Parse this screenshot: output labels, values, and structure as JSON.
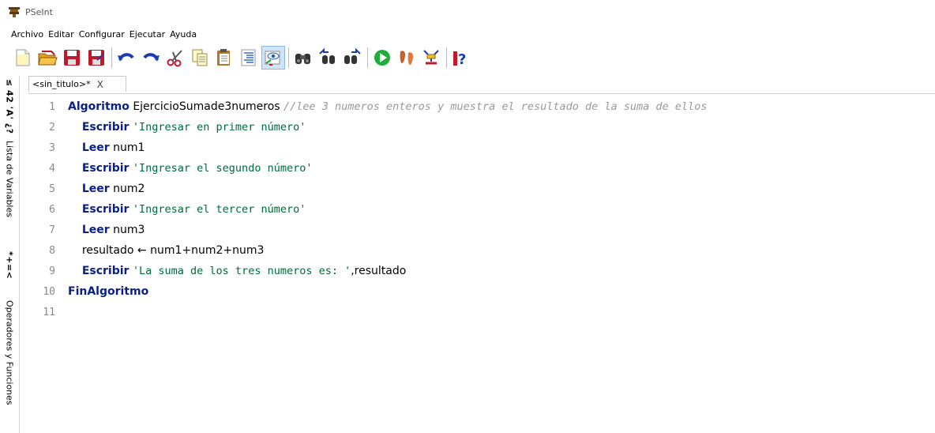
{
  "app": {
    "title": "PSeInt"
  },
  "menu": [
    "Archivo",
    "Editar",
    "Configurar",
    "Ejecutar",
    "Ayuda"
  ],
  "toolbar": {
    "buttons": [
      "new-file-icon",
      "open-folder-icon",
      "save-icon",
      "save-as-icon",
      "undo-icon",
      "redo-icon",
      "cut-icon",
      "copy-icon",
      "paste-icon",
      "indent-icon",
      "inspect-icon",
      "find-icon",
      "find-previous-icon",
      "find-next-icon",
      "run-icon",
      "step-by-step-icon",
      "flowchart-icon",
      "help-icon"
    ],
    "active": "inspect-icon"
  },
  "side_panel": {
    "symbols_top": "≤ 42 'A' ¿?",
    "variables": "Lista de Variables",
    "symbols_mid": "*+=<",
    "operators": "Operadores y Funciones"
  },
  "tab": {
    "label": "<sin_titulo>*",
    "close": "X"
  },
  "editor": {
    "lines": [
      {
        "n": "1",
        "indent": "",
        "kw": "Algoritmo",
        "text": " EjercicioSumade3numeros ",
        "str": "",
        "cmt": "//lee 3 numeros enteros y muestra el resultado de la suma de ellos"
      },
      {
        "n": "2",
        "indent": "    ",
        "kw": "Escribir",
        "text": " ",
        "str": "'Ingresar en primer número'",
        "cmt": ""
      },
      {
        "n": "3",
        "indent": "    ",
        "kw": "Leer",
        "text": " num1",
        "str": "",
        "cmt": ""
      },
      {
        "n": "4",
        "indent": "    ",
        "kw": "Escribir",
        "text": " ",
        "str": "'Ingresar el segundo número'",
        "cmt": ""
      },
      {
        "n": "5",
        "indent": "    ",
        "kw": "Leer",
        "text": " num2",
        "str": "",
        "cmt": ""
      },
      {
        "n": "6",
        "indent": "    ",
        "kw": "Escribir",
        "text": " ",
        "str": "'Ingresar el tercer número'",
        "cmt": ""
      },
      {
        "n": "7",
        "indent": "    ",
        "kw": "Leer",
        "text": " num3",
        "str": "",
        "cmt": ""
      },
      {
        "n": "8",
        "indent": "    ",
        "kw": "",
        "text": "resultado ← num1+num2+num3",
        "str": "",
        "cmt": ""
      },
      {
        "n": "9",
        "indent": "    ",
        "kw": "Escribir",
        "text": " ",
        "str": "'La suma de los tres numeros es: '",
        "tail": ",resultado",
        "cmt": ""
      },
      {
        "n": "10",
        "indent": "",
        "kw": "FinAlgoritmo",
        "text": "",
        "str": "",
        "cmt": ""
      },
      {
        "n": "11",
        "indent": "",
        "kw": "",
        "text": "",
        "str": "",
        "cmt": ""
      }
    ]
  },
  "colors": {
    "keyword": "#0a1f8a",
    "string": "#006b3b",
    "comment": "#999999",
    "line_number": "#8a8a8a"
  }
}
